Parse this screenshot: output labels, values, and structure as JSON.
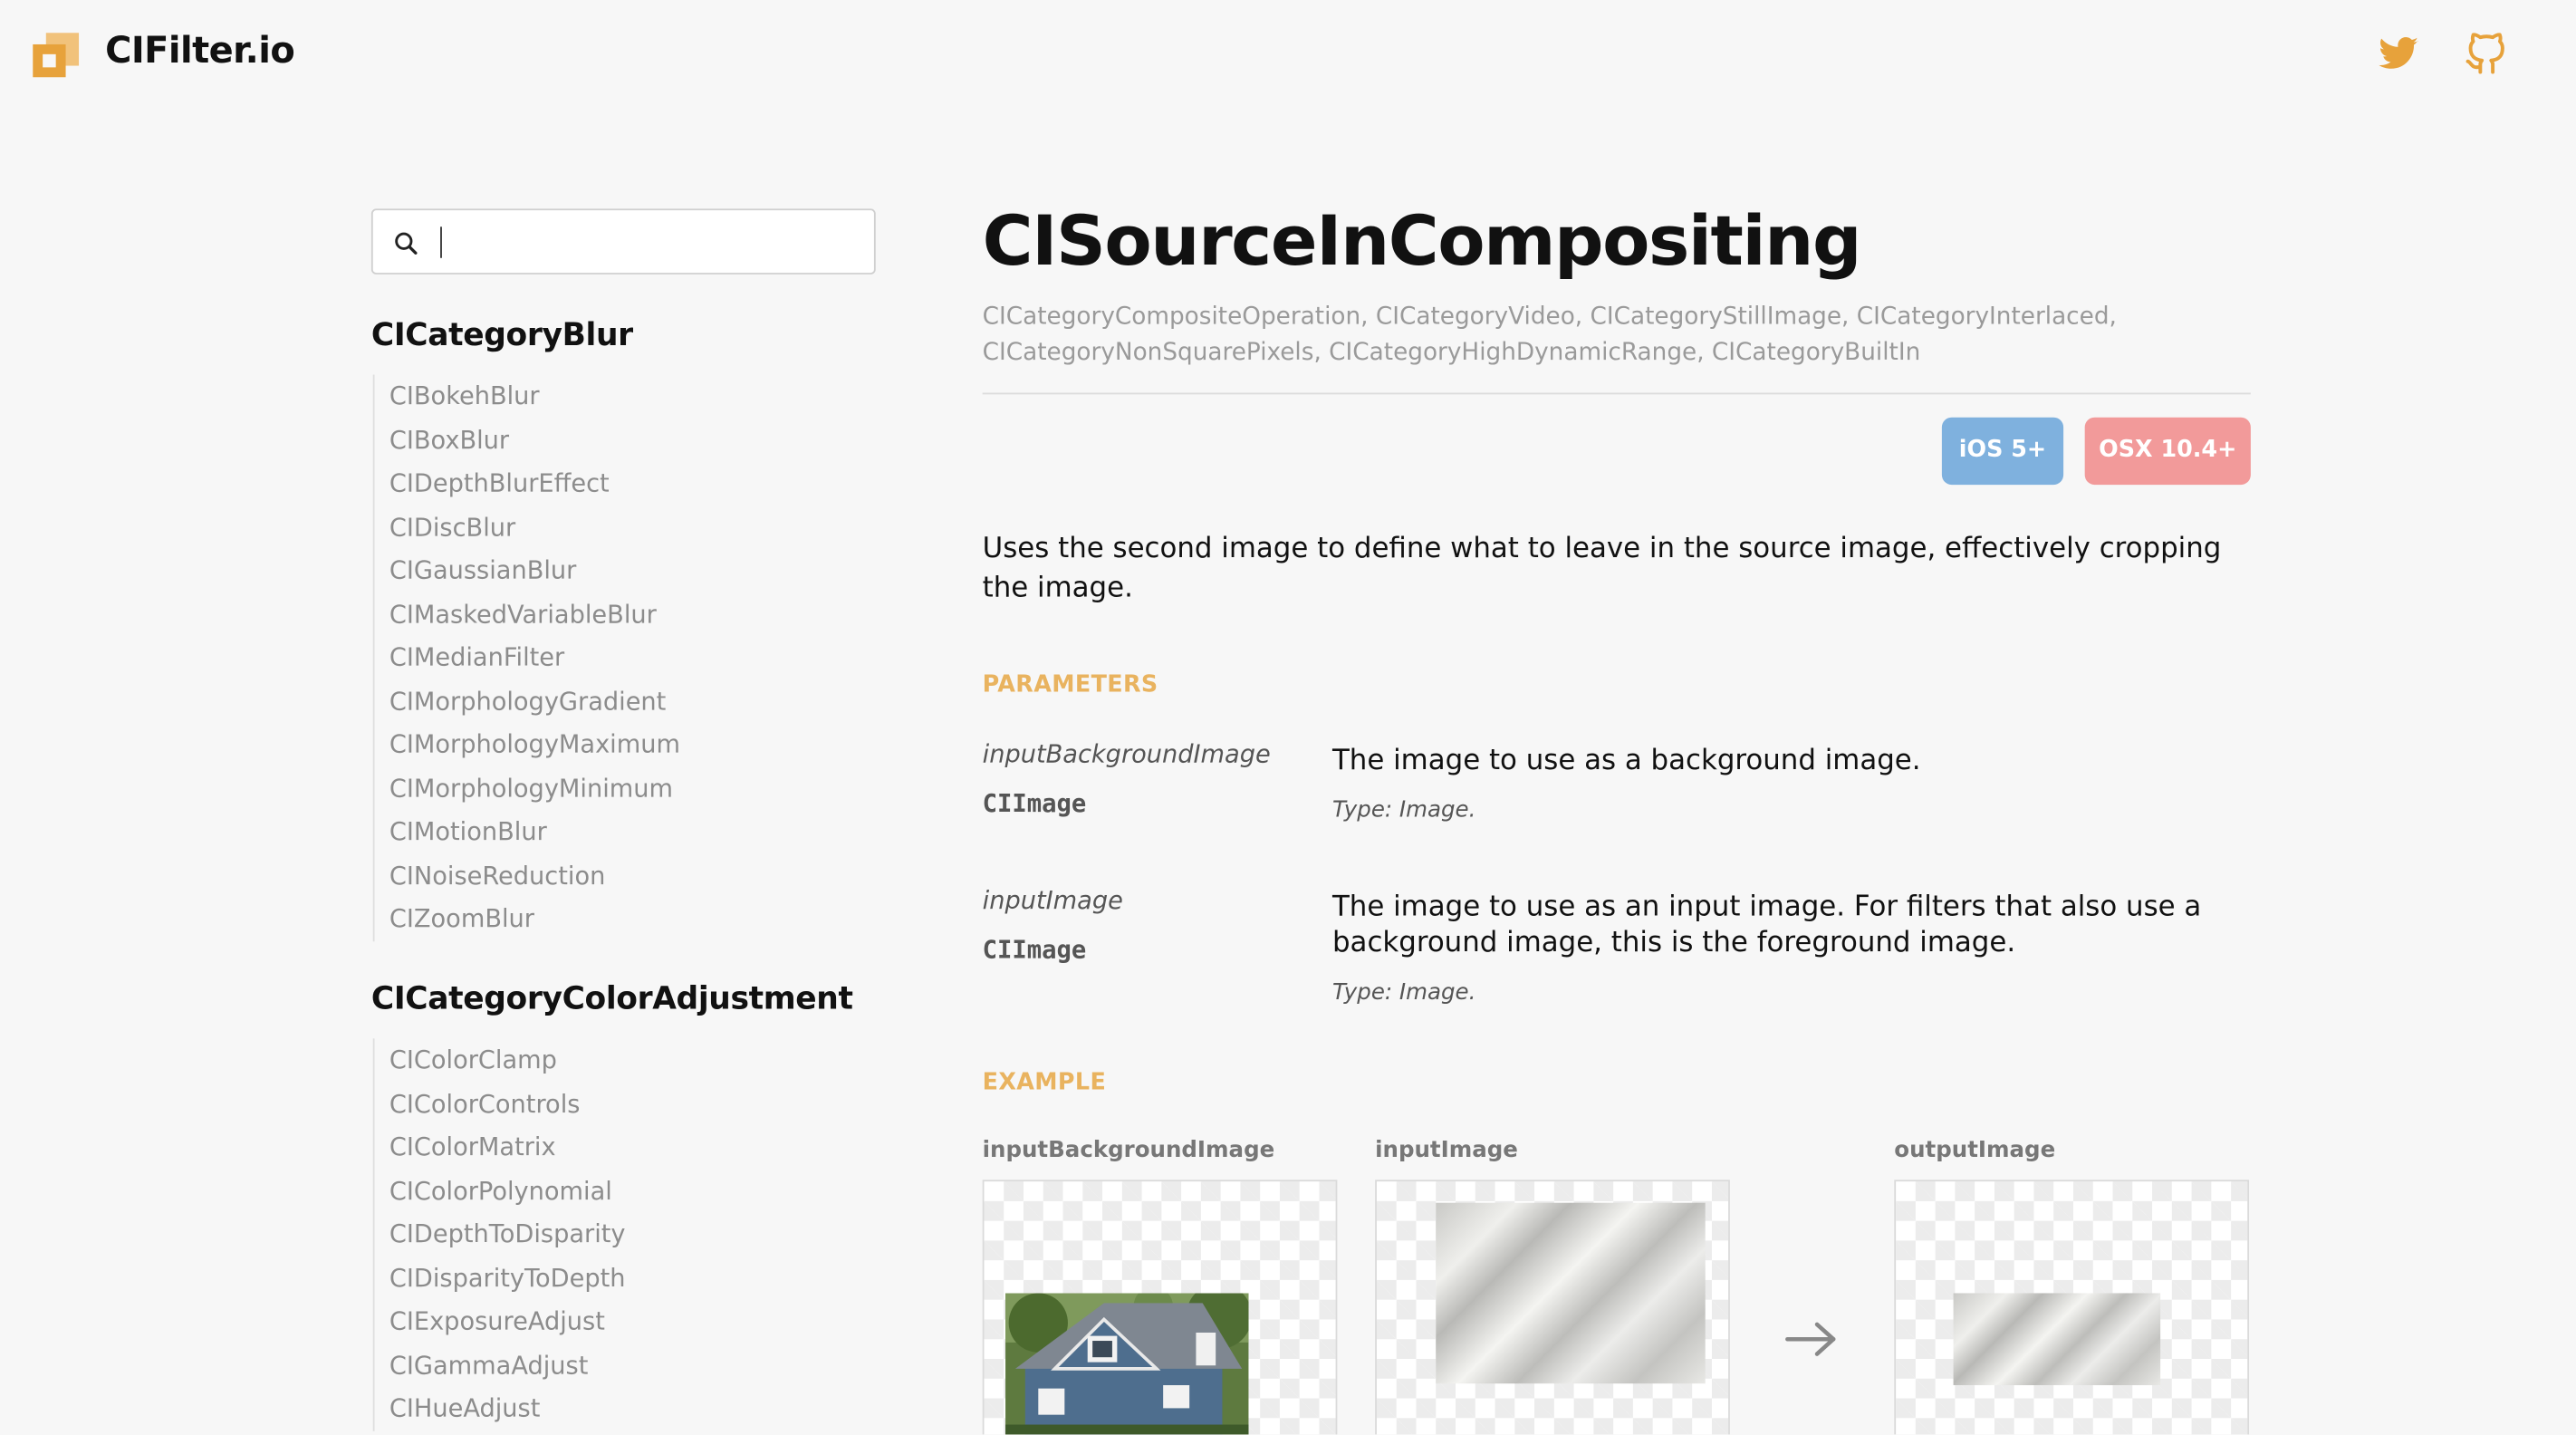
{
  "header": {
    "brand": "CIFilter.io",
    "icons": [
      "twitter-icon",
      "github-icon"
    ],
    "accent_color": "#e7a23b"
  },
  "search": {
    "placeholder": "",
    "value": ""
  },
  "sidebar": {
    "categories": [
      {
        "title": "CICategoryBlur",
        "items": [
          "CIBokehBlur",
          "CIBoxBlur",
          "CIDepthBlurEffect",
          "CIDiscBlur",
          "CIGaussianBlur",
          "CIMaskedVariableBlur",
          "CIMedianFilter",
          "CIMorphologyGradient",
          "CIMorphologyMaximum",
          "CIMorphologyMinimum",
          "CIMotionBlur",
          "CINoiseReduction",
          "CIZoomBlur"
        ]
      },
      {
        "title": "CICategoryColorAdjustment",
        "items": [
          "CIColorClamp",
          "CIColorControls",
          "CIColorMatrix",
          "CIColorPolynomial",
          "CIDepthToDisparity",
          "CIDisparityToDepth",
          "CIExposureAdjust",
          "CIGammaAdjust",
          "CIHueAdjust"
        ]
      }
    ]
  },
  "filter": {
    "name": "CISourceInCompositing",
    "categories": "CICategoryCompositeOperation, CICategoryVideo, CICategoryStillImage, CICategoryInterlaced, CICategoryNonSquarePixels, CICategoryHighDynamicRange, CICategoryBuiltIn",
    "badges": {
      "ios": "iOS 5+",
      "osx": "OSX 10.4+"
    },
    "badge_colors": {
      "ios": "#7fb1de",
      "osx": "#f29a9a"
    },
    "description": "Uses the second image to define what to leave in the source image, effectively cropping the image.",
    "parameters_heading": "PARAMETERS",
    "parameters": [
      {
        "name": "inputBackgroundImage",
        "type": "CIImage",
        "description": "The image to use as a background image.",
        "meta": "Type: Image."
      },
      {
        "name": "inputImage",
        "type": "CIImage",
        "description": "The image to use as an input image. For filters that also use a background image, this is the foreground image.",
        "meta": "Type: Image."
      }
    ],
    "example_heading": "EXAMPLE",
    "example_labels": [
      "inputBackgroundImage",
      "inputImage",
      "outputImage"
    ]
  }
}
